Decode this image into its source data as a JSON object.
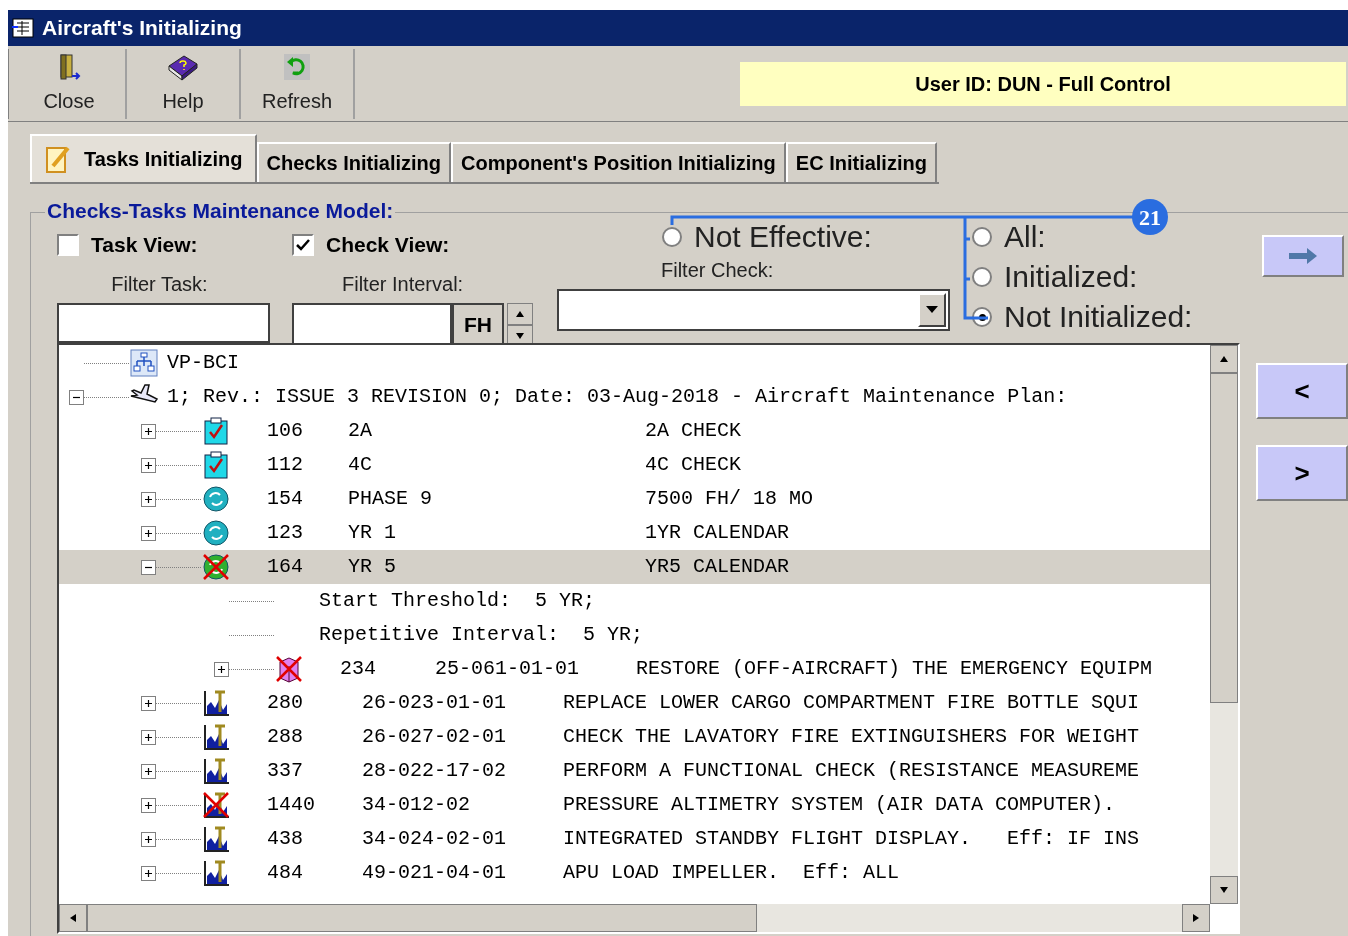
{
  "window": {
    "title": "Aircraft's Initializing"
  },
  "toolbar": [
    {
      "kind": "close",
      "label": "Close"
    },
    {
      "kind": "help",
      "label": "Help"
    },
    {
      "kind": "refresh",
      "label": "Refresh"
    }
  ],
  "user_banner": "User ID: DUN - Full Control",
  "tabs": [
    {
      "label": "Tasks Initializing",
      "selected": true
    },
    {
      "label": "Checks Initializing",
      "selected": false
    },
    {
      "label": "Component's Position Initializing",
      "selected": false
    },
    {
      "label": "EC Initializing",
      "selected": false
    }
  ],
  "group": {
    "title": "Checks-Tasks Maintenance Model:",
    "task_view": {
      "label": "Task View:",
      "checked": false
    },
    "check_view": {
      "label": "Check View:",
      "checked": true
    },
    "filter_task": {
      "label": "Filter Task:"
    },
    "filter_interval": {
      "label": "Filter Interval:",
      "unit": "FH"
    },
    "filter_check": {
      "label": "Filter Check:"
    },
    "radios": [
      {
        "label": "Not Effective:",
        "selected": false
      },
      {
        "label": "All:",
        "selected": false
      },
      {
        "label": "Initialized:",
        "selected": false
      },
      {
        "label": "Not Initialized:",
        "selected": true
      }
    ]
  },
  "callout": {
    "number": "21"
  },
  "nav_buttons": [
    {
      "kind": "arrow"
    },
    {
      "kind": "text",
      "label": "<"
    },
    {
      "kind": "text",
      "label": ">"
    }
  ],
  "tree": [
    {
      "kind": "site",
      "text": "VP-BCI",
      "selected": false
    },
    {
      "kind": "plan",
      "text": "1; Rev.: ISSUE 3 REVISION 0; Date: 03-Aug-2018 - Aircraft Maintenance Plan:",
      "selected": false,
      "expanded": true,
      "children": [
        {
          "kind": "check-list",
          "number": "106",
          "code": "2A",
          "description": "2A CHECK",
          "selected": false,
          "expanded": false,
          "crossed": false
        },
        {
          "kind": "check-list",
          "number": "112",
          "code": "4C",
          "description": "4C CHECK",
          "selected": false,
          "expanded": false,
          "crossed": false
        },
        {
          "kind": "check-cycle",
          "number": "154",
          "code": "PHASE 9",
          "description": "7500 FH/ 18 MO",
          "selected": false,
          "expanded": false,
          "crossed": false
        },
        {
          "kind": "check-cycle",
          "number": "123",
          "code": "YR 1",
          "description": "1YR CALENDAR",
          "selected": false,
          "expanded": false,
          "crossed": false
        },
        {
          "kind": "check-cycle",
          "number": "164",
          "code": "YR 5",
          "description": "YR5 CALENDAR",
          "selected": true,
          "expanded": true,
          "crossed": true,
          "children": [
            {
              "kind": "detail",
              "text": "Start Threshold:  5 YR;",
              "selected": false
            },
            {
              "kind": "detail",
              "text": "Repetitive Interval:  5 YR;",
              "selected": false
            },
            {
              "kind": "task-part",
              "number": "234",
              "code": "25-061-01-01",
              "description": "RESTORE (OFF-AIRCRAFT) THE EMERGENCY EQUIPM",
              "selected": false,
              "expanded": false,
              "crossed": true
            }
          ]
        },
        {
          "kind": "task",
          "number": "280",
          "code": "26-023-01-01",
          "description": "REPLACE LOWER CARGO COMPARTMENT FIRE BOTTLE SQUI",
          "selected": false,
          "expanded": false,
          "crossed": false
        },
        {
          "kind": "task",
          "number": "288",
          "code": "26-027-02-01",
          "description": "CHECK THE LAVATORY FIRE EXTINGUISHERS FOR WEIGHT",
          "selected": false,
          "expanded": false,
          "crossed": false
        },
        {
          "kind": "task",
          "number": "337",
          "code": "28-022-17-02",
          "description": "PERFORM A FUNCTIONAL CHECK (RESISTANCE MEASUREME",
          "selected": false,
          "expanded": false,
          "crossed": false
        },
        {
          "kind": "task",
          "number": "1440",
          "code": "34-012-02",
          "description": "PRESSURE ALTIMETRY SYSTEM (AIR DATA COMPUTER).",
          "selected": false,
          "expanded": false,
          "crossed": true
        },
        {
          "kind": "task",
          "number": "438",
          "code": "34-024-02-01",
          "description": "INTEGRATED STANDBY FLIGHT DISPLAY.   Eff: IF INS",
          "selected": false,
          "expanded": false,
          "crossed": false
        },
        {
          "kind": "task",
          "number": "484",
          "code": "49-021-04-01",
          "description": "APU LOAD IMPELLER.  Eff: ALL",
          "selected": false,
          "expanded": false,
          "crossed": false
        }
      ]
    }
  ]
}
